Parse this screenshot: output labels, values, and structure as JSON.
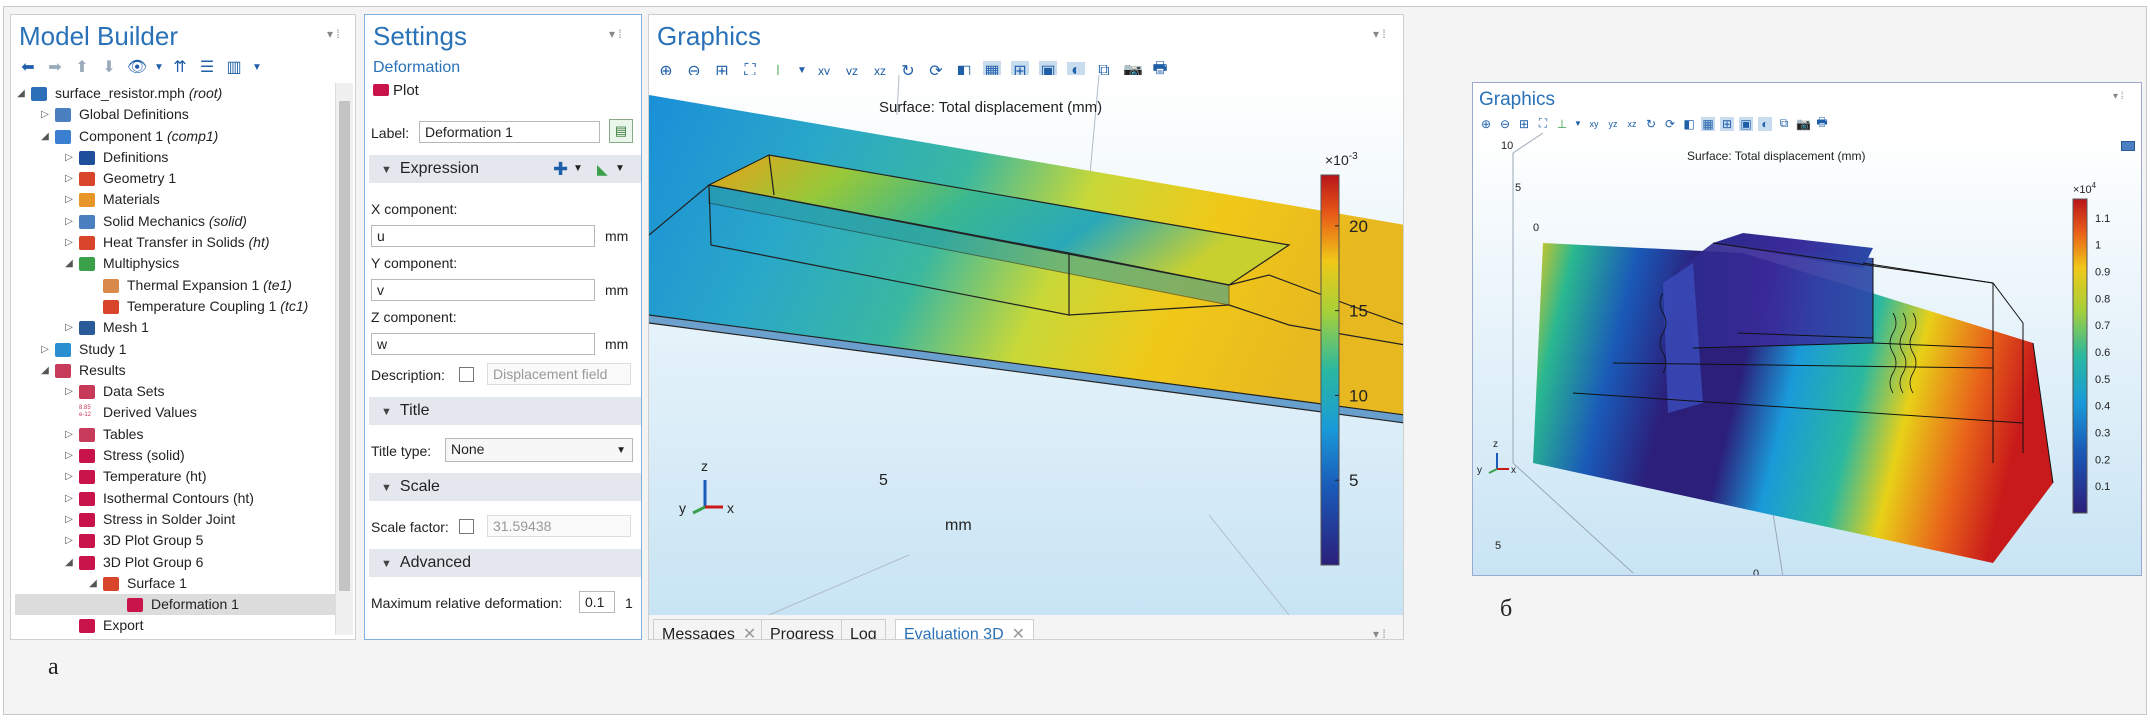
{
  "model_builder": {
    "title": "Model Builder",
    "tree": [
      {
        "label": "surface_resistor.mph",
        "tag": "(root)",
        "icon": "root-icon",
        "color": "#2a6fb8",
        "expanded": true,
        "level": 0
      },
      {
        "label": "Global Definitions",
        "tag": "",
        "icon": "globe-icon",
        "color": "#4a7fc0",
        "collapsed": true,
        "level": 1
      },
      {
        "label": "Component 1",
        "tag": "(comp1)",
        "icon": "component-icon",
        "color": "#3a7fd0",
        "expanded": true,
        "level": 1
      },
      {
        "label": "Definitions",
        "tag": "",
        "icon": "definitions-icon",
        "color": "#1f4f9a",
        "collapsed": true,
        "level": 2
      },
      {
        "label": "Geometry 1",
        "tag": "",
        "icon": "geometry-icon",
        "color": "#d9452a",
        "collapsed": true,
        "level": 2
      },
      {
        "label": "Materials",
        "tag": "",
        "icon": "materials-icon",
        "color": "#e8962a",
        "collapsed": true,
        "level": 2
      },
      {
        "label": "Solid Mechanics",
        "tag": "(solid)",
        "icon": "solid-mechanics-icon",
        "color": "#4a7fc0",
        "collapsed": true,
        "level": 2
      },
      {
        "label": "Heat Transfer in Solids",
        "tag": "(ht)",
        "icon": "heat-transfer-icon",
        "color": "#d9452a",
        "collapsed": true,
        "level": 2
      },
      {
        "label": "Multiphysics",
        "tag": "",
        "icon": "multiphysics-icon",
        "color": "#3aa04a",
        "expanded": true,
        "level": 2
      },
      {
        "label": "Thermal Expansion 1",
        "tag": "(te1)",
        "icon": "thermal-expansion-icon",
        "color": "#d98a4a",
        "level": 3
      },
      {
        "label": "Temperature Coupling 1",
        "tag": "(tc1)",
        "icon": "temperature-coupling-icon",
        "color": "#d9452a",
        "level": 3
      },
      {
        "label": "Mesh 1",
        "tag": "",
        "icon": "mesh-icon",
        "color": "#2a5a9a",
        "collapsed": true,
        "level": 2
      },
      {
        "label": "Study 1",
        "tag": "",
        "icon": "study-icon",
        "color": "#2a8fd0",
        "collapsed": true,
        "level": 1
      },
      {
        "label": "Results",
        "tag": "",
        "icon": "results-icon",
        "color": "#c83a5a",
        "expanded": true,
        "level": 1
      },
      {
        "label": "Data Sets",
        "tag": "",
        "icon": "data-sets-icon",
        "color": "#c83a5a",
        "collapsed": true,
        "level": 2
      },
      {
        "label": "Derived Values",
        "tag": "",
        "icon": "derived-values-icon",
        "color": "#c83a5a",
        "level": 2,
        "icon_text": "8.85\ne-12"
      },
      {
        "label": "Tables",
        "tag": "",
        "icon": "tables-icon",
        "color": "#c83a5a",
        "collapsed": true,
        "level": 2
      },
      {
        "label": "Stress (solid)",
        "tag": "",
        "icon": "plot-group-icon",
        "color": "#c8144a",
        "collapsed": true,
        "level": 2
      },
      {
        "label": "Temperature (ht)",
        "tag": "",
        "icon": "plot-group-icon",
        "color": "#c8144a",
        "collapsed": true,
        "level": 2
      },
      {
        "label": "Isothermal Contours (ht)",
        "tag": "",
        "icon": "plot-group-icon",
        "color": "#c8144a",
        "collapsed": true,
        "level": 2
      },
      {
        "label": "Stress in Solder Joint",
        "tag": "",
        "icon": "plot-group-icon",
        "color": "#c8144a",
        "collapsed": true,
        "level": 2
      },
      {
        "label": "3D Plot Group 5",
        "tag": "",
        "icon": "plot-group-icon",
        "color": "#c8144a",
        "collapsed": true,
        "level": 2
      },
      {
        "label": "3D Plot Group 6",
        "tag": "",
        "icon": "plot-group-icon",
        "color": "#c8144a",
        "expanded": true,
        "level": 2
      },
      {
        "label": "Surface 1",
        "tag": "",
        "icon": "surface-icon",
        "color": "#d9452a",
        "expanded": true,
        "level": 3
      },
      {
        "label": "Deformation 1",
        "tag": "",
        "icon": "deformation-icon",
        "color": "#c8144a",
        "level": 4,
        "selected": true
      },
      {
        "label": "Export",
        "tag": "",
        "icon": "export-icon",
        "color": "#c8144a",
        "level": 2
      }
    ]
  },
  "settings": {
    "title": "Settings",
    "subtitle": "Deformation",
    "plot_button": "Plot",
    "label_label": "Label:",
    "label_value": "Deformation 1",
    "expression_header": "Expression",
    "x_label": "X component:",
    "x_value": "u",
    "y_label": "Y component:",
    "y_value": "v",
    "z_label": "Z component:",
    "z_value": "w",
    "unit": "mm",
    "description_label": "Description:",
    "description_placeholder": "Displacement field",
    "title_header": "Title",
    "title_type_label": "Title type:",
    "title_type_value": "None",
    "scale_header": "Scale",
    "scale_factor_label": "Scale factor:",
    "scale_factor_value": "31.59438",
    "advanced_header": "Advanced",
    "max_def_label": "Maximum relative deformation:",
    "max_def_value": "0.1",
    "max_def_trail": "1"
  },
  "graphics": {
    "title": "Graphics",
    "plot_title": "Surface: Total displacement (mm)",
    "colorbar_exponent": "×10",
    "colorbar_exponent_power": "-3",
    "colorbar_ticks": [
      "20",
      "15",
      "10",
      "5"
    ],
    "colorbar_max": 23,
    "axis_tick_5": "5",
    "axis_unit": "mm",
    "triad_z": "z",
    "triad_y": "y",
    "triad_x": "x",
    "tabs": [
      "Messages",
      "Progress",
      "Log",
      "Evaluation 3D"
    ],
    "active_tab": "Evaluation 3D",
    "colors": {
      "low": "#2b1f7a",
      "mid": "#2bb8a8",
      "high": "#e8c818",
      "top": "#b8141a"
    }
  },
  "graphics_b": {
    "title": "Graphics",
    "plot_title": "Surface: Total displacement (mm)",
    "colorbar_exponent": "×10",
    "colorbar_exponent_power": "4",
    "colorbar_ticks": [
      "1.1",
      "1",
      "0.9",
      "0.8",
      "0.7",
      "0.6",
      "0.5",
      "0.4",
      "0.3",
      "0.2",
      "0.1"
    ],
    "axis_ticks": [
      "10",
      "5",
      "0",
      "5",
      "0"
    ],
    "triad_z": "z",
    "triad_y": "y",
    "triad_x": "x"
  },
  "captions": {
    "a": "а",
    "b": "б"
  }
}
